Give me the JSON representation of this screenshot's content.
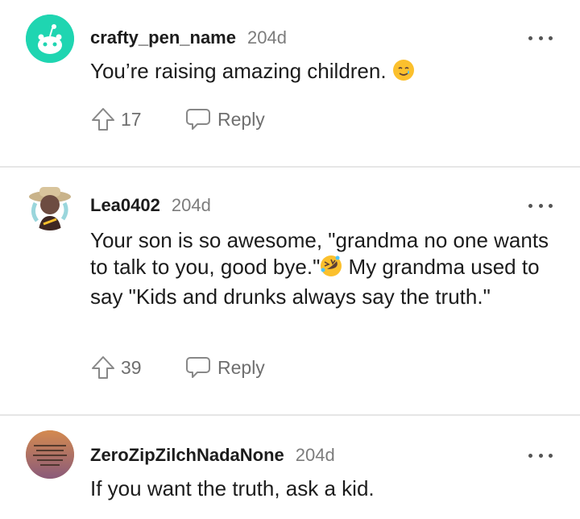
{
  "comments": [
    {
      "username": "crafty_pen_name",
      "age": "204d",
      "text": "You’re raising amazing children.",
      "emoji": "smiling-face-with-tear",
      "upvotes": "17",
      "reply_label": "Reply"
    },
    {
      "username": "Lea0402",
      "age": "204d",
      "text_part1": "Your son is so awesome, \"grandma no one wants to talk to you, good bye.\"",
      "emoji": "rolling-on-floor-laughing",
      "text_part2": " My grandma used to say \"Kids and drunks always say the truth.\"",
      "upvotes": "39",
      "reply_label": "Reply"
    },
    {
      "username": "ZeroZipZilchNadaNone",
      "age": "204d",
      "text": "If you want the truth, ask a kid."
    }
  ],
  "colors": {
    "avatar1": "#1fd5b1",
    "avatar3": "#b97a4a",
    "divider": "#e6e6e6",
    "muted": "#7c7c7c"
  }
}
